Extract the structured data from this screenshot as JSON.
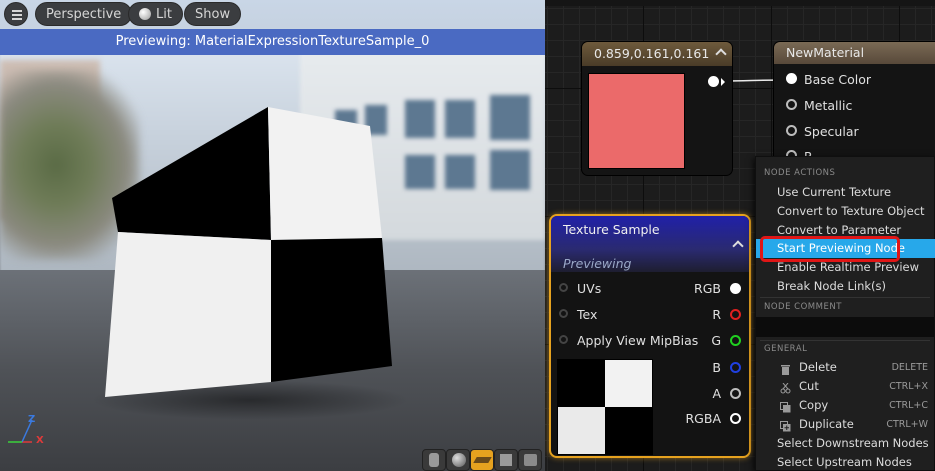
{
  "viewport": {
    "menu_icon": "hamburger-icon",
    "perspective_label": "Perspective",
    "lit_label": "Lit",
    "show_label": "Show",
    "preview_banner": "Previewing: MaterialExpressionTextureSample_0",
    "axis": {
      "z": "Z",
      "x": "X"
    }
  },
  "graph": {
    "constant_node": {
      "title": "0.859,0.161,0.161",
      "color": "#db2929"
    },
    "material_node": {
      "title": "NewMaterial",
      "inputs": [
        "Base Color",
        "Metallic",
        "Specular",
        "R"
      ]
    },
    "texture_node": {
      "title": "Texture Sample",
      "subtitle": "Previewing",
      "inputs": [
        "UVs",
        "Tex",
        "Apply View MipBias"
      ],
      "outputs": [
        "RGB",
        "R",
        "G",
        "B",
        "A",
        "RGBA"
      ],
      "output_colors": [
        "#ffffff",
        "#e02020",
        "#20d020",
        "#2040e0",
        "#bdbdbd",
        "#ffffff"
      ]
    }
  },
  "context_menu": {
    "section_node_actions": "NODE ACTIONS",
    "items": [
      "Use Current Texture",
      "Convert to Texture Object",
      "Convert to Parameter",
      "Start Previewing Node",
      "Enable Realtime Preview",
      "Break Node Link(s)"
    ],
    "highlighted": "Start Previewing Node",
    "section_node_comment": "NODE COMMENT",
    "section_general": "GENERAL",
    "general_items": [
      {
        "label": "Delete",
        "shortcut": "DELETE",
        "icon": "trash-icon"
      },
      {
        "label": "Cut",
        "shortcut": "CTRL+X",
        "icon": "scissors-icon"
      },
      {
        "label": "Copy",
        "shortcut": "CTRL+C",
        "icon": "copy-icon"
      },
      {
        "label": "Duplicate",
        "shortcut": "CTRL+W",
        "icon": "duplicate-icon"
      }
    ],
    "more_items": [
      "Select Downstream Nodes",
      "Select Upstream Nodes"
    ]
  }
}
